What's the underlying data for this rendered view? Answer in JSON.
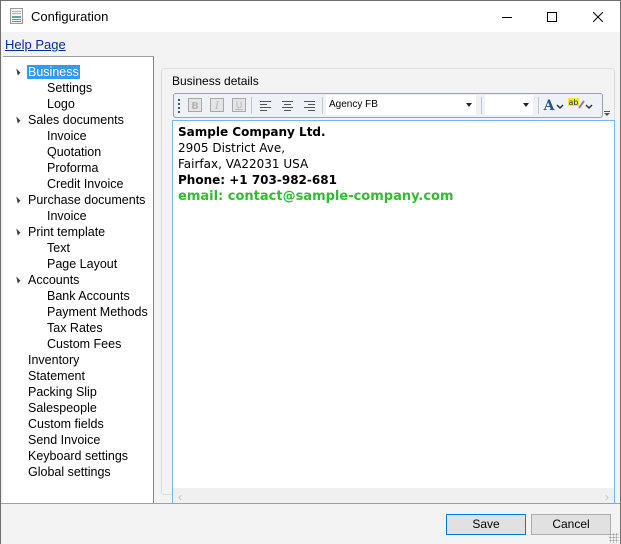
{
  "window": {
    "title": "Configuration",
    "icon": "document-icon",
    "controls": {
      "minimize": "minimize-icon",
      "maximize": "maximize-icon",
      "close": "close-icon"
    }
  },
  "menu": {
    "help_link": "Help Page"
  },
  "tree": {
    "items": [
      {
        "label": "Business",
        "level": 0,
        "expanded": true,
        "selected": true
      },
      {
        "label": "Settings",
        "level": 1
      },
      {
        "label": "Logo",
        "level": 1
      },
      {
        "label": "Sales documents",
        "level": 0,
        "expanded": true
      },
      {
        "label": "Invoice",
        "level": 1
      },
      {
        "label": "Quotation",
        "level": 1
      },
      {
        "label": "Proforma",
        "level": 1
      },
      {
        "label": "Credit Invoice",
        "level": 1
      },
      {
        "label": "Purchase documents",
        "level": 0,
        "expanded": true
      },
      {
        "label": "Invoice",
        "level": 1
      },
      {
        "label": "Print template",
        "level": 0,
        "expanded": true
      },
      {
        "label": "Text",
        "level": 1
      },
      {
        "label": "Page Layout",
        "level": 1
      },
      {
        "label": "Accounts",
        "level": 0,
        "expanded": true
      },
      {
        "label": "Bank Accounts",
        "level": 1
      },
      {
        "label": "Payment Methods",
        "level": 1
      },
      {
        "label": "Tax Rates",
        "level": 1
      },
      {
        "label": "Custom Fees",
        "level": 1
      },
      {
        "label": "Inventory",
        "level": 0
      },
      {
        "label": "Statement",
        "level": 0
      },
      {
        "label": "Packing Slip",
        "level": 0
      },
      {
        "label": "Salespeople",
        "level": 0
      },
      {
        "label": "Custom fields",
        "level": 0
      },
      {
        "label": "Send Invoice",
        "level": 0
      },
      {
        "label": "Keyboard settings",
        "level": 0
      },
      {
        "label": "Global settings",
        "level": 0
      }
    ]
  },
  "details": {
    "group_title": "Business details",
    "toolbar": {
      "bold": "bold-icon",
      "italic": "italic-icon",
      "underline": "underline-icon",
      "align_left": "align-left-icon",
      "align_center": "align-center-icon",
      "align_right": "align-right-icon",
      "font_family": "Agency FB",
      "font_size": "",
      "font_color": "font-color-icon",
      "highlight": "highlight-icon"
    },
    "editor": {
      "company": "Sample Company Ltd.",
      "address1": "2905 District Ave,",
      "address2": "Fairfax, VA22031 USA",
      "phone": "Phone: +1 703-982-681",
      "email": "email: contact@sample-company.com",
      "email_color": "#33bb33"
    }
  },
  "buttons": {
    "save": "Save",
    "cancel": "Cancel"
  },
  "colors": {
    "selection": "#3399ff",
    "link": "#0b2a8f",
    "accent": "#0078d7"
  }
}
